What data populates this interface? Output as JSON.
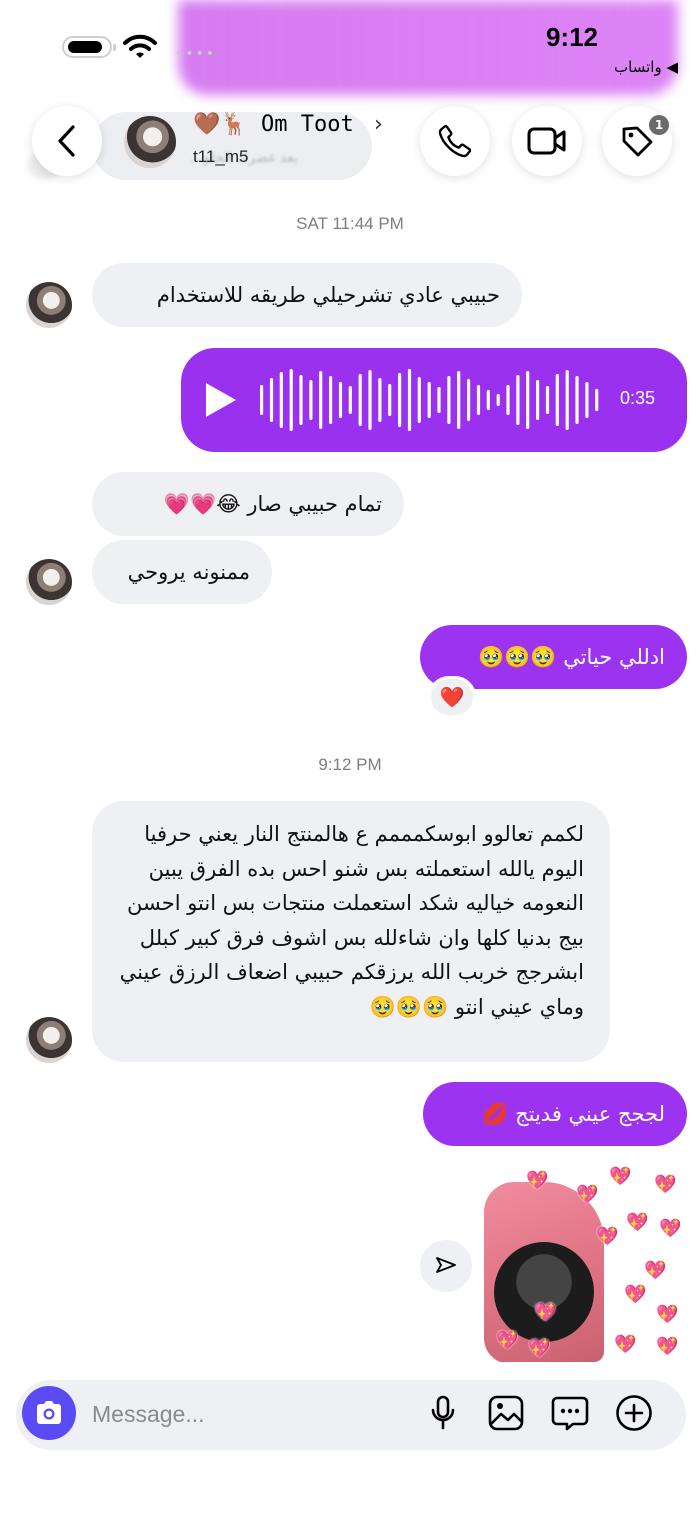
{
  "status_bar": {
    "time": "9:12",
    "back_to_app": "◀ واتساب"
  },
  "header": {
    "contact_name": "🤎🦌 Om Toot",
    "username": "t11_m5",
    "obscured_text": "بعد غضرك الحلو...",
    "notification_badge": "1",
    "icons": [
      "chevron-left-icon",
      "phone-icon",
      "video-icon",
      "tag-icon"
    ]
  },
  "messages": {
    "stamp1": "SAT 11:44 PM",
    "m1": "حبيبي عادي تشرحيلي طريقه للاستخدام",
    "voice": {
      "duration": "0:35"
    },
    "m2": "تمام حبيبي صار 😂💗💗",
    "m3": "ممنونه يروحي",
    "m4": "ادللي حياتي 🥹🥹🥹",
    "m4_reaction": "❤️",
    "stamp2": "9:12 PM",
    "m5": "لكمم تعالوو ابوسكمممم ع هالمنتج النار يعني حرفيا اليوم يالله استعملته بس شنو احس بده الفرق يبين النعومه خياليه شكد استعملت منتجات بس انتو احسن بيج بدنيا كلها وان شاءلله بس اشوف فرق كبير كبلل ابشرجج خربب الله يرزقكم حبيبي اضعاف الرزق عيني وماي عيني انتو 🥹🥹🥹",
    "m6": "لججج عيني فديتج 💋"
  },
  "composer": {
    "placeholder": "Message...",
    "icons": [
      "camera-icon",
      "microphone-icon",
      "image-icon",
      "sticker-icon",
      "plus-icon"
    ]
  },
  "colors": {
    "outgoing": "#9c33f0",
    "incoming": "#eff0f4",
    "camera_button": "#5b4bf5",
    "timestamp": "#7b7e84"
  }
}
